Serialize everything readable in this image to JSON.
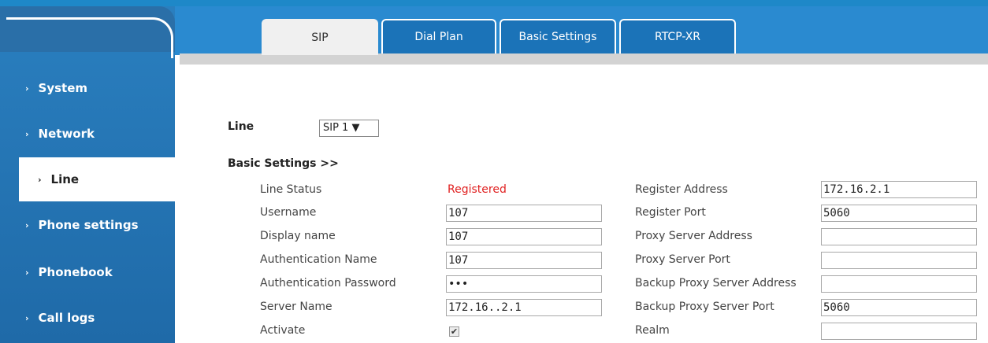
{
  "sidebar": {
    "items": [
      {
        "label": "System",
        "active": false
      },
      {
        "label": "Network",
        "active": false
      },
      {
        "label": "Line",
        "active": true
      },
      {
        "label": "Phone settings",
        "active": false
      },
      {
        "label": "Phonebook",
        "active": false
      },
      {
        "label": "Call logs",
        "active": false
      }
    ]
  },
  "tabs": [
    {
      "label": "SIP",
      "active": true
    },
    {
      "label": "Dial Plan",
      "active": false
    },
    {
      "label": "Basic Settings",
      "active": false
    },
    {
      "label": "RTCP-XR",
      "active": false
    }
  ],
  "line": {
    "label": "Line",
    "selected": "SIP 1 ▼"
  },
  "section_title": "Basic Settings >>",
  "left_fields": {
    "line_status": {
      "label": "Line Status",
      "value": "Registered"
    },
    "username": {
      "label": "Username",
      "value": "107"
    },
    "display_name": {
      "label": "Display name",
      "value": "107"
    },
    "auth_name": {
      "label": "Authentication Name",
      "value": "107"
    },
    "auth_password": {
      "label": "Authentication Password",
      "value": "•••"
    },
    "server_name": {
      "label": "Server Name",
      "value": "172.16..2.1"
    },
    "activate": {
      "label": "Activate",
      "checked": true,
      "check_glyph": "✔"
    }
  },
  "right_fields": {
    "register_address": {
      "label": "Register Address",
      "value": "172.16.2.1"
    },
    "register_port": {
      "label": "Register Port",
      "value": "5060"
    },
    "proxy_address": {
      "label": "Proxy Server Address",
      "value": ""
    },
    "proxy_port": {
      "label": "Proxy Server Port",
      "value": ""
    },
    "backup_proxy_address": {
      "label": "Backup Proxy Server Address",
      "value": ""
    },
    "backup_proxy_port": {
      "label": "Backup Proxy Server Port",
      "value": "5060"
    },
    "realm": {
      "label": "Realm",
      "value": ""
    }
  },
  "colors": {
    "accent": "#1e88c8",
    "sidebar": "#2a7fbf",
    "status": "#e02020"
  },
  "nav_icon": "chevron-right-icon"
}
